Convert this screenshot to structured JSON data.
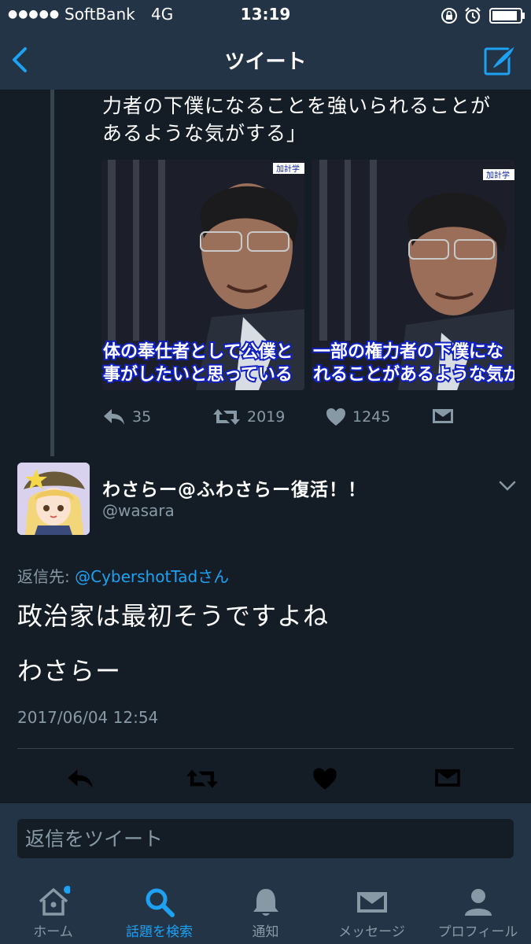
{
  "status_bar": {
    "signal": "●●●●●",
    "carrier": "SoftBank",
    "network": "4G",
    "time": "13:19"
  },
  "nav": {
    "title": "ツイート",
    "back_icon": "chevron-left-icon",
    "compose_icon": "compose-quill-icon"
  },
  "quoted_tweet": {
    "text_lines": [
      "力者の下僕になることを強いられることが",
      "あるような気がする」"
    ],
    "media": [
      {
        "caption_line1": "体の奉仕者として公僕と",
        "caption_line2": "事がしたいと思っている",
        "corner_tag": "加計学"
      },
      {
        "caption_line1": "一部の権力者の下僕にな",
        "caption_line2": "れることがあるような気が",
        "corner_tag": "加計学"
      }
    ],
    "actions": {
      "replies": "35",
      "retweets": "2019",
      "likes": "1245"
    }
  },
  "tweet": {
    "display_name": "わさらー@ふわさらー復活！！",
    "handle": "@wasara",
    "reply_prefix": "返信先: ",
    "reply_user": "@CybershotTadさん",
    "text_line1": "政治家は最初そうですよね",
    "text_line2": "わさらー",
    "timestamp": "2017/06/04 12:54"
  },
  "reply_box": {
    "placeholder": "返信をツイート"
  },
  "tabs": [
    {
      "label": "ホーム",
      "icon": "home-icon",
      "active": false
    },
    {
      "label": "話題を検索",
      "icon": "search-icon",
      "active": true
    },
    {
      "label": "通知",
      "icon": "bell-icon",
      "active": false
    },
    {
      "label": "メッセージ",
      "icon": "envelope-icon",
      "active": false
    },
    {
      "label": "プロフィール",
      "icon": "person-icon",
      "active": false
    }
  ],
  "colors": {
    "background": "#141d26",
    "bar": "#243447",
    "accent": "#1da1f2",
    "muted": "#8899a6",
    "caption_text": "#ffffff",
    "caption_bg": "#0a1aa8"
  }
}
